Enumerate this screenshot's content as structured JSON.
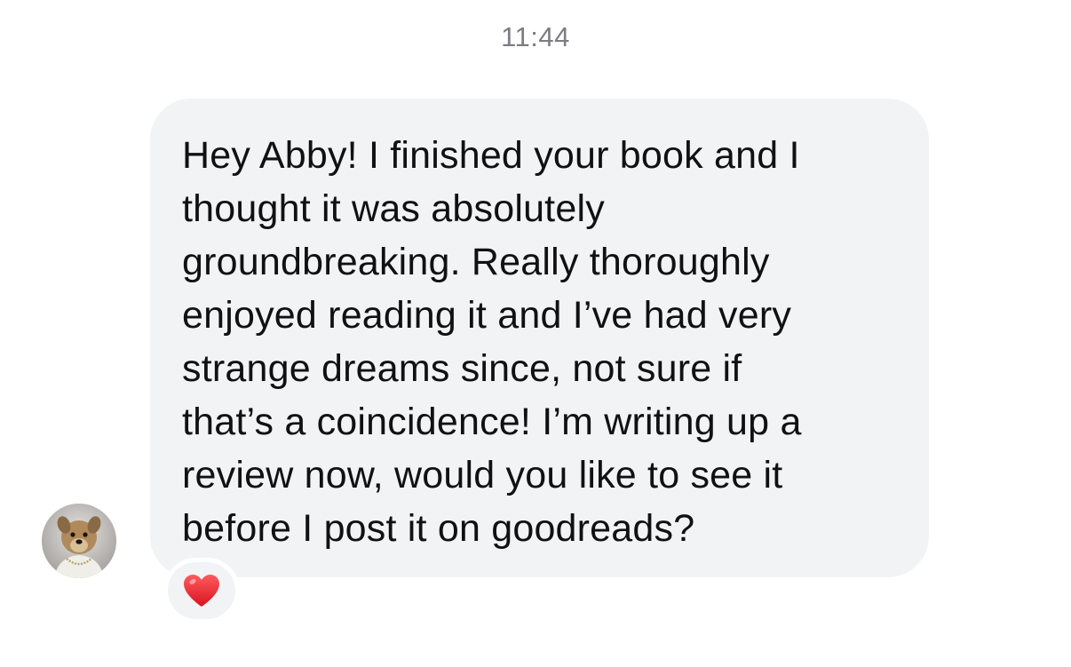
{
  "thread": {
    "timestamp": "11:44"
  },
  "message": {
    "text": "Hey Abby! I finished your book and I\nthought it was absolutely\ngroundbreaking. Really thoroughly\nenjoyed reading it and I’ve had very\nstrange dreams since, not sure if\nthat’s a coincidence! I’m writing up a\nreview now, would you like to see it\nbefore I post it on goodreads?",
    "reaction": "heart",
    "reaction_color": "#e8242c",
    "bubble_color": "#f2f3f5"
  },
  "sender": {
    "avatar_icon": "dog-avatar-icon"
  }
}
